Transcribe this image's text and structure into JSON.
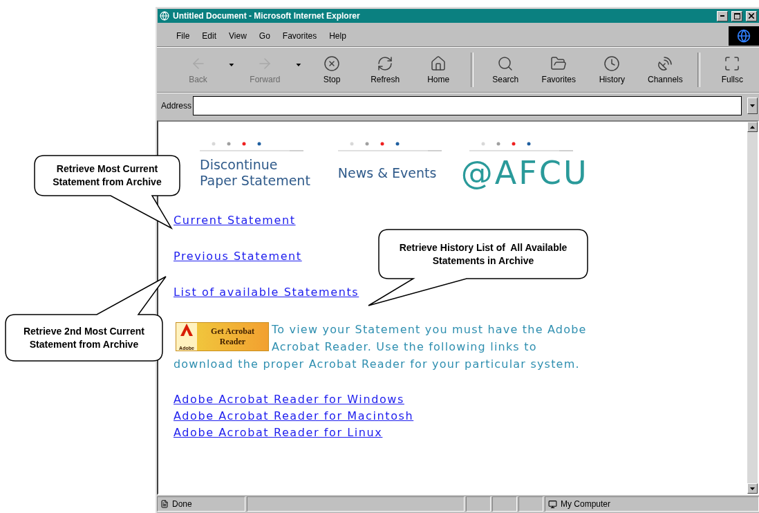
{
  "window": {
    "title": "Untitled Document - Microsoft Internet Explorer"
  },
  "menu": [
    "File",
    "Edit",
    "View",
    "Go",
    "Favorites",
    "Help"
  ],
  "toolbar": [
    {
      "label": "Back",
      "disabled": true,
      "dropdown": true
    },
    {
      "label": "Forward",
      "disabled": true,
      "dropdown": true
    },
    {
      "label": "Stop",
      "disabled": false,
      "dropdown": false
    },
    {
      "label": "Refresh",
      "disabled": false,
      "dropdown": false
    },
    {
      "label": "Home",
      "disabled": false,
      "dropdown": false
    },
    {
      "label": "Search",
      "disabled": false,
      "dropdown": false
    },
    {
      "label": "Favorites",
      "disabled": false,
      "dropdown": false
    },
    {
      "label": "History",
      "disabled": false,
      "dropdown": false
    },
    {
      "label": "Channels",
      "disabled": false,
      "dropdown": false
    },
    {
      "label": "Fullsc",
      "disabled": false,
      "dropdown": false
    }
  ],
  "address": {
    "label": "Address"
  },
  "page": {
    "banners": [
      {
        "kind": "text",
        "lines": [
          "Discontinue",
          "Paper Statement"
        ]
      },
      {
        "kind": "text",
        "lines": [
          "News & Events"
        ]
      },
      {
        "kind": "logo",
        "lines": [
          "@AFCU"
        ]
      }
    ],
    "links": [
      "Current Statement",
      "Previous Statement",
      "List of available Statements"
    ],
    "acrobat_badge": {
      "title": "Get Acrobat",
      "subtitle": "Reader",
      "brand": "Adobe"
    },
    "notice": [
      "To view your Statement you must have the Adobe Acrobat Reader. Use the following links to",
      "download the proper Acrobat Reader for your particular system."
    ],
    "download_links": [
      "Adobe Acrobat Reader for Windows",
      "Adobe Acrobat Reader for Macintosh",
      "Adobe Acrobat Reader for Linux"
    ]
  },
  "status_bar": {
    "text": "Done",
    "zone": "My Computer"
  },
  "callouts": [
    {
      "lines": [
        "Retrieve Most Current",
        "Statement from Archive"
      ]
    },
    {
      "lines": [
        "Retrieve 2nd Most Current",
        "Statement from Archive"
      ]
    },
    {
      "lines": [
        "Retrieve History List of  All Available",
        "Statements in Archive"
      ]
    }
  ]
}
